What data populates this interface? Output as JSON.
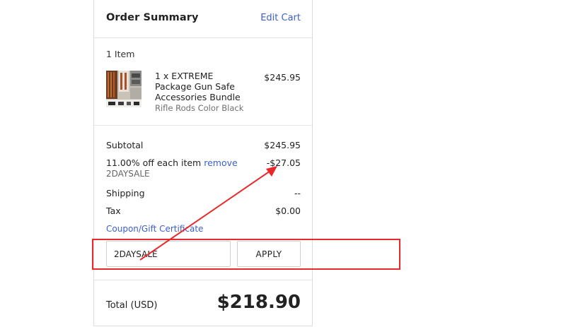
{
  "summary": {
    "title": "Order Summary",
    "edit_cart": "Edit Cart"
  },
  "items": {
    "count": "1 Item",
    "list": [
      {
        "title": "1 x EXTREME Package Gun Safe Accessories Bundle",
        "variant": "Rifle Rods Color Black",
        "price": "$245.95"
      }
    ]
  },
  "totals": {
    "subtotal_label": "Subtotal",
    "subtotal_value": "$245.95",
    "discount_label": "11.00% off each item",
    "discount_remove": "remove",
    "discount_value": "-$27.05",
    "discount_code": "2DAYSALE",
    "shipping_label": "Shipping",
    "shipping_value": "--",
    "tax_label": "Tax",
    "tax_value": "$0.00",
    "coupon_link": "Coupon/Gift Certificate"
  },
  "coupon": {
    "input_value": "2DAYSALE",
    "apply_label": "APPLY"
  },
  "grand_total": {
    "label": "Total (USD)",
    "value": "$218.90"
  },
  "annotation": {
    "color": "#e8292c"
  },
  "theme": {
    "link_color": "#3b5fcf"
  }
}
